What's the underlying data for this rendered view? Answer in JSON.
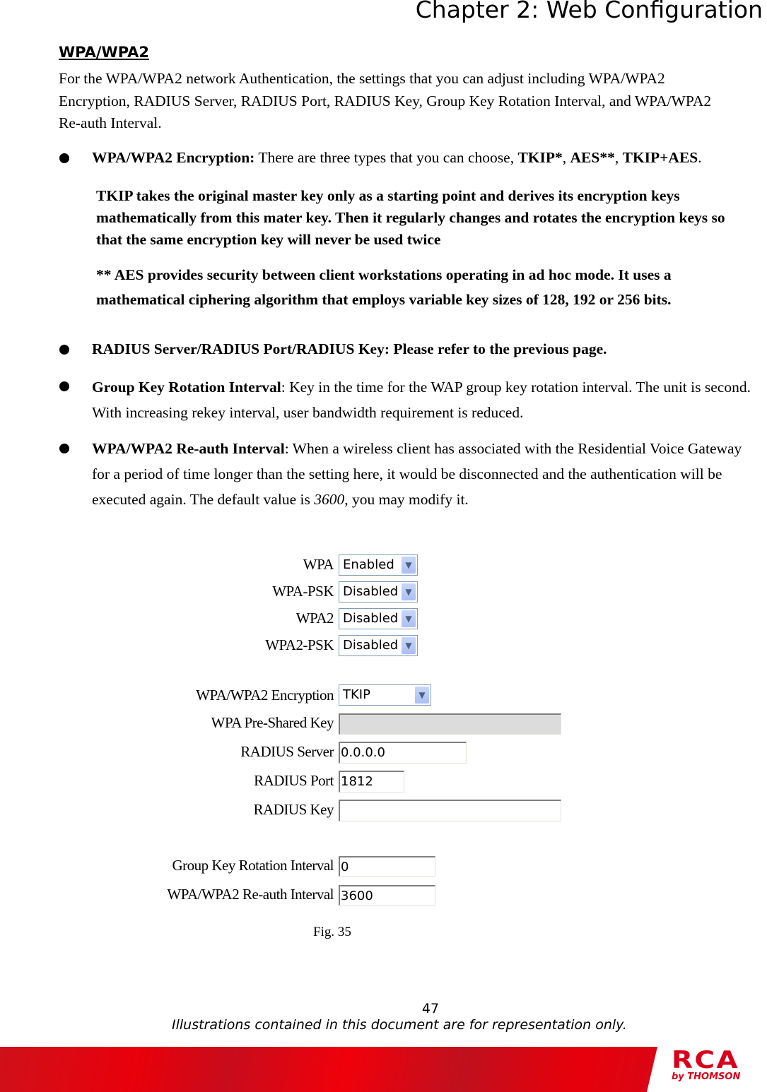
{
  "header": {
    "chapter": "Chapter 2: Web Configuration"
  },
  "section": {
    "title": "WPA/WPA2",
    "intro": "For the WPA/WPA2 network Authentication, the settings that you can adjust including WPA/WPA2 Encryption, RADIUS Server, RADIUS Port, RADIUS Key, Group Key Rotation Interval, and WPA/WPA2 Re-auth Interval."
  },
  "bullets": [
    {
      "term": "WPA/WPA2 Encryption:",
      "text_a": " There are three types that you can choose, ",
      "o1": "TKIP*",
      "sep1": ", ",
      "o2": "AES**",
      "sep2": ", ",
      "o3": "TKIP+AES",
      "end": "."
    },
    {
      "term": "RADIUS Server/RADIUS Port/RADIUS Key: Please refer to the previous page."
    },
    {
      "term": "Group Key Rotation Interval",
      "text": ": Key in the time for the WAP group key rotation interval. The unit is second. With increasing rekey interval, user bandwidth requirement is reduced."
    },
    {
      "term": "WPA/WPA2 Re-auth Interval",
      "text_a": ": When a wireless client has associated with the Residential Voice Gateway for a period of time longer than the setting here, it would be disconnected and the authentication will be executed again. The default value is ",
      "value": "3600",
      "text_b": ", you may modify it."
    }
  ],
  "notes": {
    "tkip": "TKIP takes the original master key only as a starting point and derives its encryption keys mathematically from this mater key. Then it regularly changes and rotates the encryption keys so that the same encryption key will never be used twice",
    "aes": "** AES provides security between client workstations operating in ad hoc mode. It uses a mathematical ciphering algorithm that employs variable key sizes of 128, 192 or 256 bits."
  },
  "form": {
    "wpa": {
      "label": "WPA",
      "value": "Enabled"
    },
    "wpa_psk": {
      "label": "WPA-PSK",
      "value": "Disabled"
    },
    "wpa2": {
      "label": "WPA2",
      "value": "Disabled"
    },
    "wpa2_psk": {
      "label": "WPA2-PSK",
      "value": "Disabled"
    },
    "encryption": {
      "label": "WPA/WPA2 Encryption",
      "value": "TKIP"
    },
    "psk": {
      "label": "WPA Pre-Shared Key",
      "value": ""
    },
    "radius_server": {
      "label": "RADIUS Server",
      "value": "0.0.0.0"
    },
    "radius_port": {
      "label": "RADIUS Port",
      "value": "1812"
    },
    "radius_key": {
      "label": "RADIUS Key",
      "value": ""
    },
    "group_key": {
      "label": "Group Key Rotation Interval",
      "value": "0"
    },
    "reauth": {
      "label": "WPA/WPA2 Re-auth Interval",
      "value": "3600"
    }
  },
  "figure": {
    "caption": "Fig. 35"
  },
  "footer": {
    "page": "47",
    "disclaimer": "Illustrations contained in this document are for representation only.",
    "logo": "RCA",
    "logo_sub": "by THOMSON",
    "brand_color": "#e3000f"
  }
}
